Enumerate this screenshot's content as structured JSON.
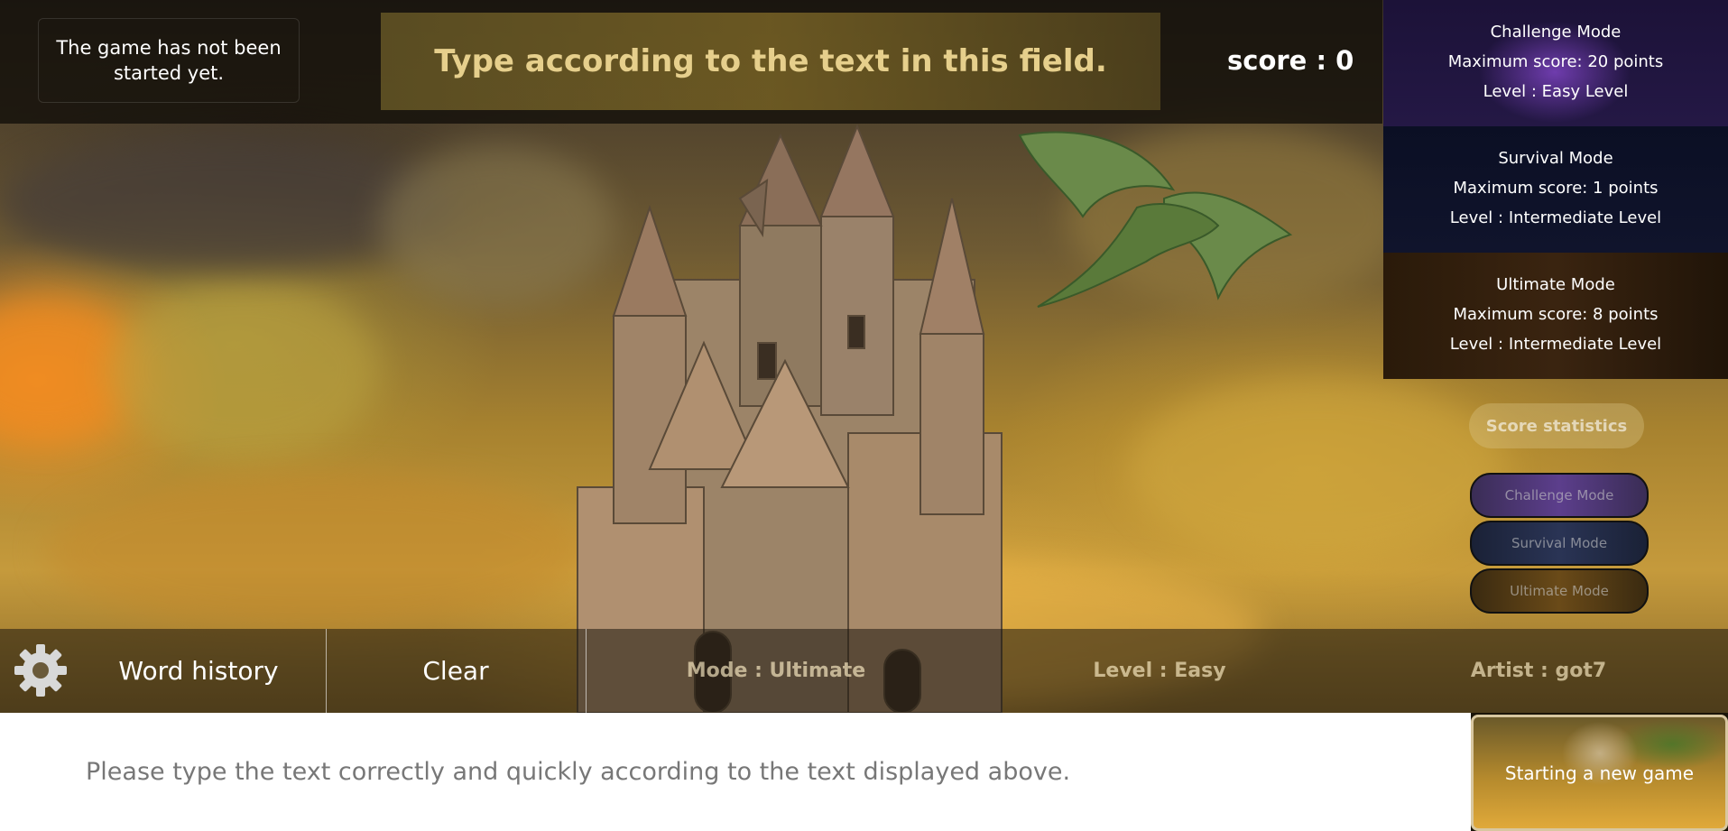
{
  "top": {
    "status": "The game has not been started yet.",
    "prompt_text": "Type according to the text in this field.",
    "score_label": "score : 0"
  },
  "modes": [
    {
      "title": "Challenge Mode",
      "max_score": "Maximum score: 20 points",
      "level": "Level : Easy Level"
    },
    {
      "title": "Survival Mode",
      "max_score": "Maximum score: 1 points",
      "level": "Level : Intermediate Level"
    },
    {
      "title": "Ultimate Mode",
      "max_score": "Maximum score: 8 points",
      "level": "Level : Intermediate Level"
    }
  ],
  "side_buttons": {
    "score_statistics": "Score statistics",
    "challenge": "Challenge Mode",
    "survival": "Survival Mode",
    "ultimate": "Ultimate Mode"
  },
  "bottom": {
    "settings_icon": "gear-icon",
    "word_history": "Word history",
    "clear": "Clear",
    "mode": "Mode : Ultimate",
    "level": "Level : Easy",
    "artist": "Artist : got7"
  },
  "input": {
    "placeholder": "Please type the text correctly and quickly according to the text displayed above.",
    "value": ""
  },
  "new_game": "Starting a new game",
  "colors": {
    "prompt_text": "#e6cf8c",
    "white_area": "#ffffff"
  }
}
